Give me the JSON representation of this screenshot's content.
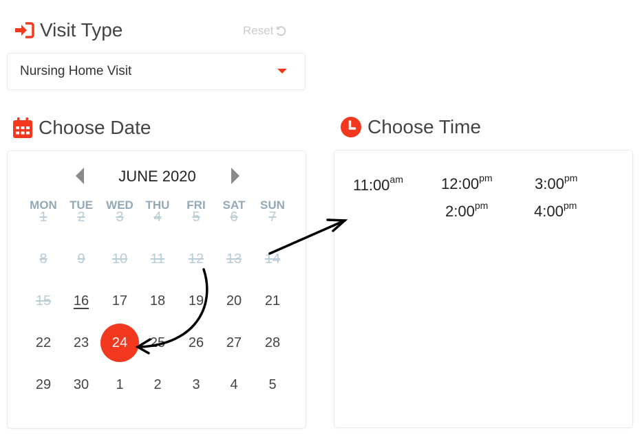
{
  "visit_type": {
    "heading": "Visit Type",
    "icon": "sign-in-icon",
    "reset_label": "Reset",
    "selected": "Nursing Home Visit"
  },
  "date": {
    "heading": "Choose Date",
    "icon": "calendar-icon",
    "month_label": "JUNE 2020",
    "weekdays": [
      "MON",
      "TUE",
      "WED",
      "THU",
      "FRI",
      "SAT",
      "SUN"
    ],
    "weeks": [
      [
        {
          "d": "1",
          "s": "disabled"
        },
        {
          "d": "2",
          "s": "disabled"
        },
        {
          "d": "3",
          "s": "disabled"
        },
        {
          "d": "4",
          "s": "disabled"
        },
        {
          "d": "5",
          "s": "disabled"
        },
        {
          "d": "6",
          "s": "disabled"
        },
        {
          "d": "7",
          "s": "disabled"
        }
      ],
      [
        {
          "d": "8",
          "s": "disabled"
        },
        {
          "d": "9",
          "s": "disabled"
        },
        {
          "d": "10",
          "s": "disabled"
        },
        {
          "d": "11",
          "s": "disabled"
        },
        {
          "d": "12",
          "s": "disabled"
        },
        {
          "d": "13",
          "s": "disabled"
        },
        {
          "d": "14",
          "s": "disabled"
        }
      ],
      [
        {
          "d": "15",
          "s": "disabled"
        },
        {
          "d": "16",
          "s": "today"
        },
        {
          "d": "17",
          "s": "avail"
        },
        {
          "d": "18",
          "s": "avail"
        },
        {
          "d": "19",
          "s": "avail"
        },
        {
          "d": "20",
          "s": "avail"
        },
        {
          "d": "21",
          "s": "avail"
        }
      ],
      [
        {
          "d": "22",
          "s": "avail"
        },
        {
          "d": "23",
          "s": "avail"
        },
        {
          "d": "24",
          "s": "selected"
        },
        {
          "d": "25",
          "s": "avail"
        },
        {
          "d": "26",
          "s": "avail"
        },
        {
          "d": "27",
          "s": "avail"
        },
        {
          "d": "28",
          "s": "avail"
        }
      ],
      [
        {
          "d": "29",
          "s": "avail"
        },
        {
          "d": "30",
          "s": "avail"
        },
        {
          "d": "1",
          "s": "avail"
        },
        {
          "d": "2",
          "s": "avail"
        },
        {
          "d": "3",
          "s": "avail"
        },
        {
          "d": "4",
          "s": "avail"
        },
        {
          "d": "5",
          "s": "avail"
        }
      ]
    ],
    "selected_day": "24",
    "accent": "#f2391f"
  },
  "time": {
    "heading": "Choose Time",
    "icon": "clock-icon",
    "slots": [
      {
        "time": "11:00",
        "period": "am"
      },
      {
        "time": "12:00",
        "period": "pm"
      },
      {
        "time": "3:00",
        "period": "pm"
      },
      {
        "time": "2:00",
        "period": "pm"
      },
      {
        "time": "4:00",
        "period": "pm"
      }
    ]
  }
}
